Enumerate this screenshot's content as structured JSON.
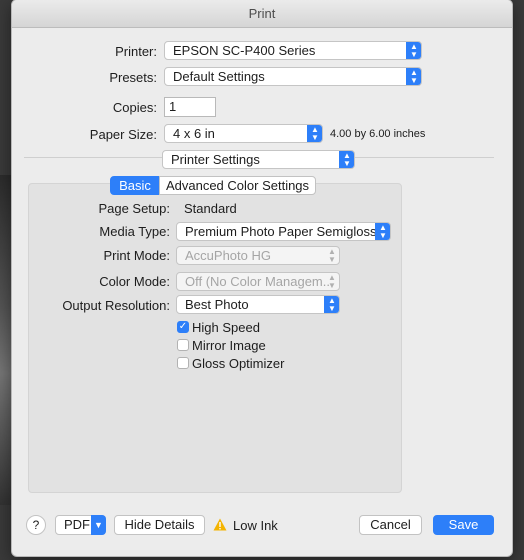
{
  "window": {
    "title": "Print"
  },
  "form": {
    "printer_label": "Printer:",
    "printer_value": "EPSON SC-P400 Series",
    "presets_label": "Presets:",
    "presets_value": "Default Settings",
    "copies_label": "Copies:",
    "copies_value": "1",
    "paper_size_label": "Paper Size:",
    "paper_size_value": "4 x 6 in",
    "paper_size_dimensions": "4.00 by 6.00 inches",
    "section_value": "Printer Settings"
  },
  "tabs": [
    {
      "label": "Basic",
      "active": true
    },
    {
      "label": "Advanced Color Settings",
      "active": false
    }
  ],
  "settings": {
    "page_setup_label": "Page Setup:",
    "page_setup_value": "Standard",
    "media_type_label": "Media Type:",
    "media_type_value": "Premium Photo Paper Semigloss",
    "print_mode_label": "Print Mode:",
    "print_mode_value": "AccuPhoto HG",
    "color_mode_label": "Color Mode:",
    "color_mode_value": "Off (No Color Managem...",
    "output_resolution_label": "Output Resolution:",
    "output_resolution_value": "Best Photo"
  },
  "checkboxes": [
    {
      "label": "High Speed",
      "checked": true
    },
    {
      "label": "Mirror Image",
      "checked": false
    },
    {
      "label": "Gloss Optimizer",
      "checked": false
    }
  ],
  "footer": {
    "help_label": "?",
    "pdf_label": "PDF",
    "hide_details_label": "Hide Details",
    "warning_text": "Low Ink",
    "cancel_label": "Cancel",
    "save_label": "Save"
  },
  "colors": {
    "accent": "#2d7ff9",
    "warning": "#f4b400"
  }
}
